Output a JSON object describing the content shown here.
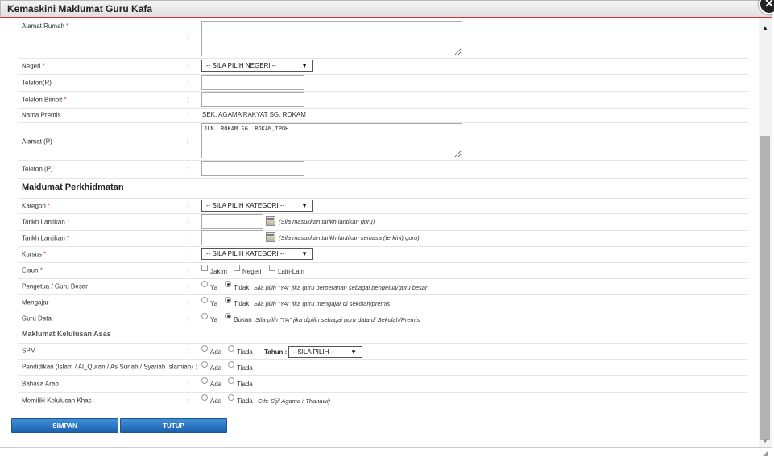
{
  "dialog": {
    "title": "Kemaskini Maklumat Guru Kafa",
    "close_symbol": "✕"
  },
  "colon": ":",
  "required_mark": "*",
  "form": {
    "alamat_rumah": {
      "label": "Alamat Rumah",
      "value": ""
    },
    "negeri": {
      "label": "Negeri",
      "value": "-- SILA PILIH NEGERI --"
    },
    "telefon_r": {
      "label": "Telefon(R)",
      "value": ""
    },
    "telefon_bimbit": {
      "label": "Telefon Bimbit",
      "value": ""
    },
    "nama_premis": {
      "label": "Nama Premis",
      "value": "SEK. AGAMA RAKYAT SG. ROKAM"
    },
    "alamat_p": {
      "label": "Alamat (P)",
      "value": "JLN. ROKAM SG. ROKAM,IPOH"
    },
    "telefon_p": {
      "label": "Telefon (P)",
      "value": ""
    }
  },
  "perkhidmatan": {
    "heading": "Maklumat Perkhidmatan",
    "kategori": {
      "label": "Kategori",
      "value": "-- SILA PILIH KATEGORI --"
    },
    "tarikh_lantikan_1": {
      "label": "Tarikh Lantikan",
      "note": "(Sila masukkan tarikh lantikan guru)"
    },
    "tarikh_lantikan_2": {
      "label": "Tarikh Lantikan",
      "note": "(Sila masukkan tarikh lantikan semasa (terkini) guru)"
    },
    "kursus": {
      "label": "Kursus",
      "value": "-- SILA PILIH KATEGORI --"
    },
    "elaun": {
      "label": "Elaun",
      "options": [
        "Jakim",
        "Negeri",
        "Lain-Lain"
      ]
    },
    "pengetua": {
      "label": "Pengetua / Guru Besar",
      "opt_yes": "Ya",
      "opt_no": "Tidak",
      "note": "Sila pilih \"YA\" jika guru berperanan sebagai pengetua/guru besar"
    },
    "mengajar": {
      "label": "Mengajar",
      "opt_yes": "Ya",
      "opt_no": "Tidak",
      "note": "Sila pilih \"YA\" jika guru mengajar di sekolah/premis"
    },
    "guru_data": {
      "label": "Guru Data",
      "opt_yes": "Ya",
      "opt_no": "Bukan",
      "note": "Sila pilih \"YA\" jika dipilih sebagai guru data di Sekolah/Premis"
    }
  },
  "kelulusan": {
    "heading": "Maklumat Kelulusan Asas",
    "spm": {
      "label": "SPM",
      "opt_yes": "Ada",
      "opt_no": "Tiada",
      "tahun_label": "Tahun :",
      "tahun_value": "--SILA PILIH--"
    },
    "pendidikan": {
      "label": "Pendidikan (Islam / Al_Quran / As Sunah / Syariah Islamiah) :",
      "opt_yes": "Ada",
      "opt_no": "Tiada"
    },
    "bahasa_arab": {
      "label": "Bahasa Arab",
      "opt_yes": "Ada",
      "opt_no": "Tiada"
    },
    "kelulusan_khas": {
      "label": "Memiliki Kelulusan Khas",
      "opt_yes": "Ada",
      "opt_no": "Tiada",
      "note": "Cth: Sijil Agama / Thanawi)"
    }
  },
  "buttons": {
    "save": "SIMPAN",
    "close": "TUTUP"
  },
  "scroll": {
    "up": "▲",
    "down": "▼"
  },
  "select_arrow": "▼",
  "resize_grip": "◢"
}
